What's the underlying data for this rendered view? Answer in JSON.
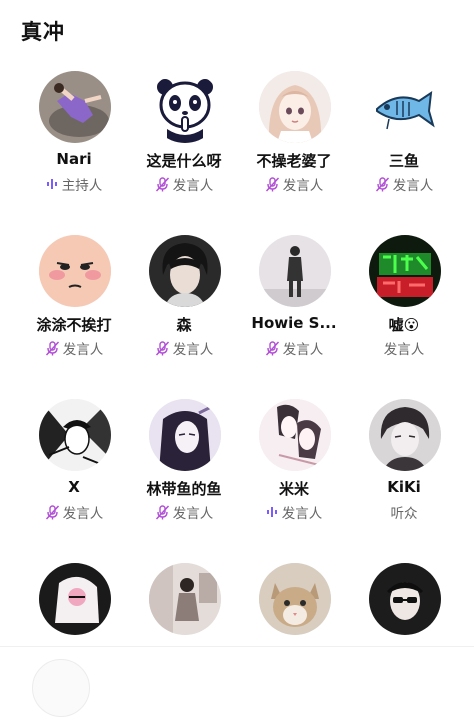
{
  "header": {
    "title": "真冲"
  },
  "members": [
    {
      "name": "Nari",
      "role": "主持人",
      "icon": "speaking-icon",
      "avatar": "person-lying-avatar"
    },
    {
      "name": "这是什么呀",
      "role": "发言人",
      "icon": "mic-muted-icon",
      "avatar": "panda-avatar"
    },
    {
      "name": "不操老婆了",
      "role": "发言人",
      "icon": "mic-muted-icon",
      "avatar": "anime-girl-avatar"
    },
    {
      "name": "三鱼",
      "role": "发言人",
      "icon": "mic-muted-icon",
      "avatar": "fish-avatar"
    },
    {
      "name": "涂涂不挨打",
      "role": "发言人",
      "icon": "mic-muted-icon",
      "avatar": "cartoon-face-avatar"
    },
    {
      "name": "森",
      "role": "发言人",
      "icon": "mic-muted-icon",
      "avatar": "young-man-avatar"
    },
    {
      "name": "Howie S...",
      "role": "发言人",
      "icon": "mic-muted-icon",
      "avatar": "standing-man-avatar"
    },
    {
      "name": "嘘😮",
      "role": "发言人",
      "icon": "",
      "avatar": "neon-sign-avatar"
    },
    {
      "name": "X",
      "role": "发言人",
      "icon": "mic-muted-icon",
      "avatar": "manga-sketch-avatar"
    },
    {
      "name": "林带鱼的鱼",
      "role": "发言人",
      "icon": "mic-muted-icon",
      "avatar": "manga-longhair-avatar"
    },
    {
      "name": "米米",
      "role": "发言人",
      "icon": "speaking-icon",
      "avatar": "manga-couple-avatar"
    },
    {
      "name": "KiKi",
      "role": "听众",
      "icon": "",
      "avatar": "manga-boy-avatar"
    },
    {
      "name": "",
      "role": "",
      "icon": "",
      "avatar": "bw-drawing-avatar"
    },
    {
      "name": "",
      "role": "",
      "icon": "",
      "avatar": "girl-photo-avatar"
    },
    {
      "name": "",
      "role": "",
      "icon": "",
      "avatar": "cat-avatar"
    },
    {
      "name": "",
      "role": "",
      "icon": "",
      "avatar": "sunglasses-avatar"
    }
  ],
  "colors": {
    "muted": "#b14fd6",
    "speaking": "#7a5cff",
    "text": "#111111",
    "subtext": "#666666"
  }
}
